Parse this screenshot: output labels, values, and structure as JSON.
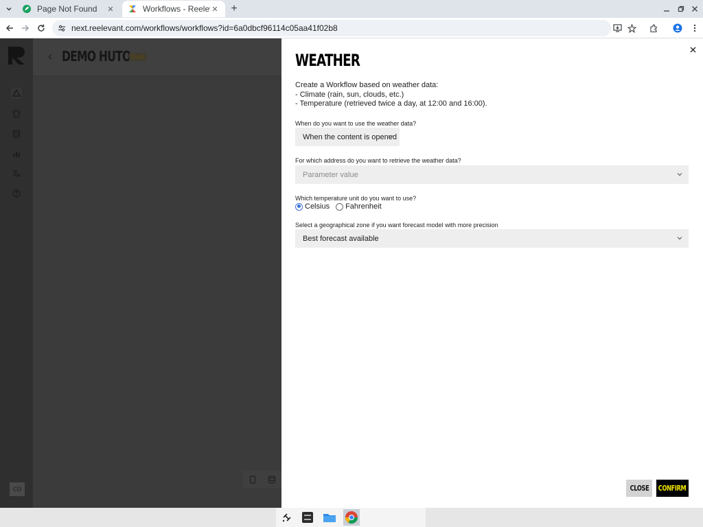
{
  "browser": {
    "tabs": [
      {
        "title": "Page Not Found",
        "active": false,
        "icon": "green-leaf-favicon"
      },
      {
        "title": "Workflows - Reelevant",
        "active": true,
        "icon": "reelevant-favicon"
      }
    ],
    "url": "next.reelevant.com/workflows/workflows?id=6a0dbcf96114c05aa41f02b8"
  },
  "app": {
    "project_title": "DEMO HUTO",
    "status_badge": "Draft",
    "avatar_initials": "CD",
    "sidebar_icons": [
      "workflow-icon",
      "shirt-icon",
      "database-icon",
      "analytics-icon",
      "users-settings-icon",
      "help-icon"
    ]
  },
  "modal": {
    "title": "WEATHER",
    "description": [
      "Create a Workflow based on weather data:",
      "- Climate (rain, sun, clouds, etc.)",
      "- Temperature (retrieved twice a day, at 12:00 and 16:00)."
    ],
    "when_label": "When do you want to use the weather data?",
    "when_value": "When the content is opened",
    "address_label": "For which address do you want to retrieve the weather data?",
    "address_placeholder": "Parameter value",
    "unit_label": "Which temperature unit do you want to use?",
    "unit_options": [
      "Celsius",
      "Fahrenheit"
    ],
    "unit_selected": "Celsius",
    "zone_label": "Select a geographical zone if you want forecast model with more precision",
    "zone_value": "Best forecast available",
    "close_button": "CLOSE",
    "confirm_button": "CONFIRM"
  },
  "colors": {
    "confirm_text": "#f2e600",
    "radio_accent": "#3b6fd8",
    "overlay": "#3b3b3b"
  }
}
